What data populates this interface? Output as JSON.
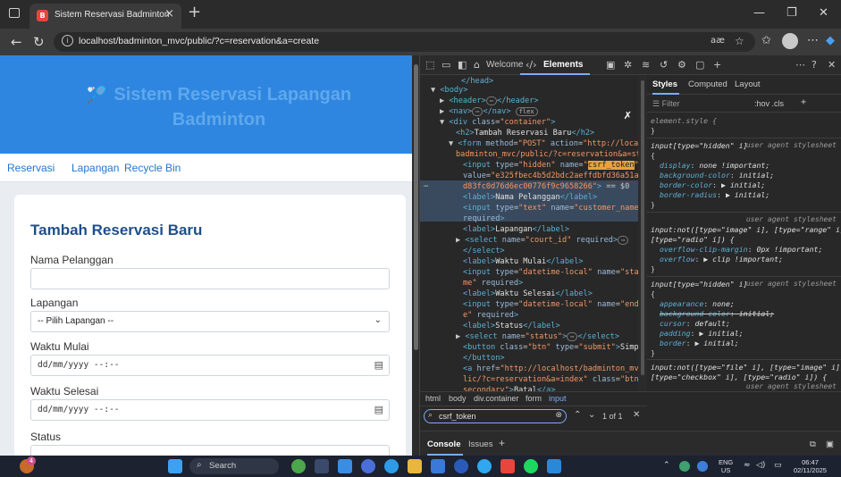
{
  "browser": {
    "tab_title": "Sistem Reservasi Badminton",
    "tab_favicon": "B",
    "url": "localhost/badminton_mvc/public/?c=reservation&a=create",
    "reader_icon_text": "aæ"
  },
  "page": {
    "site_title": "Sistem Reservasi Lapangan Badminton",
    "logo_icon": "shuttlecock-icon",
    "nav": [
      "Reservasi",
      "Lapangan",
      "Recycle Bin"
    ],
    "form": {
      "title": "Tambah Reservasi Baru",
      "label_customer": "Nama Pelanggan",
      "label_court": "Lapangan",
      "court_placeholder": "-- Pilih Lapangan --",
      "label_start": "Waktu Mulai",
      "start_value": "dd/mm/yyyy --:--",
      "label_end": "Waktu Selesai",
      "end_value": "dd/mm/yyyy --:--",
      "label_status": "Status"
    }
  },
  "devtools": {
    "tabs": [
      "Welcome",
      "Elements"
    ],
    "styles_tabs": [
      "Styles",
      "Computed",
      "Layout"
    ],
    "filter_placeholder": "Filter",
    "filter_buttons": ":hov .cls",
    "breadcrumbs": [
      "html",
      "body",
      "div.container",
      "form",
      "input"
    ],
    "find_query": "csrf_token",
    "find_count": "1 of 1",
    "drawer_tabs": [
      "Console",
      "Issues"
    ]
  },
  "taskbar": {
    "search_label": "Search",
    "lang_top": "ENG",
    "lang_bottom": "US",
    "time": "06:47",
    "date": "02/11/2025",
    "notification_count": "4"
  },
  "colors": {
    "header_blue": "#2f86e0",
    "link_blue": "#2176d3",
    "form_title": "#1f4f8a",
    "devtools_accent": "#7cacf8"
  }
}
